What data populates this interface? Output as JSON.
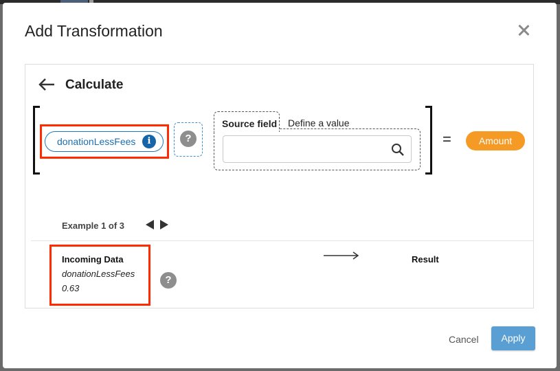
{
  "dialog": {
    "title": "Add Transformation",
    "close_icon": "close-icon"
  },
  "panel": {
    "heading": "Calculate",
    "back_icon": "arrow-left-icon"
  },
  "expression": {
    "operand_field": "donationLessFees",
    "operand_icon": "info-icon",
    "info_glyph": "i",
    "help_glyph": "?",
    "source_tabs": {
      "active": "Source field",
      "inactive": "Define a value"
    },
    "search": {
      "value": "",
      "placeholder": "",
      "icon": "search-icon"
    },
    "equals": "=",
    "target_field": "Amount"
  },
  "example": {
    "label": "Example 1 of 3",
    "prev_icon": "triangle-left-icon",
    "next_icon": "triangle-right-icon",
    "incoming_title": "Incoming Data",
    "incoming_field": "donationLessFees",
    "incoming_value": "0.63",
    "result_label": "Result"
  },
  "footer": {
    "cancel_label": "Cancel",
    "apply_label": "Apply"
  },
  "colors": {
    "field_pill": "#1e78bf",
    "target_pill": "#f49a25",
    "apply_button": "#5a9fd4",
    "highlight_box": "#ff2a00"
  }
}
